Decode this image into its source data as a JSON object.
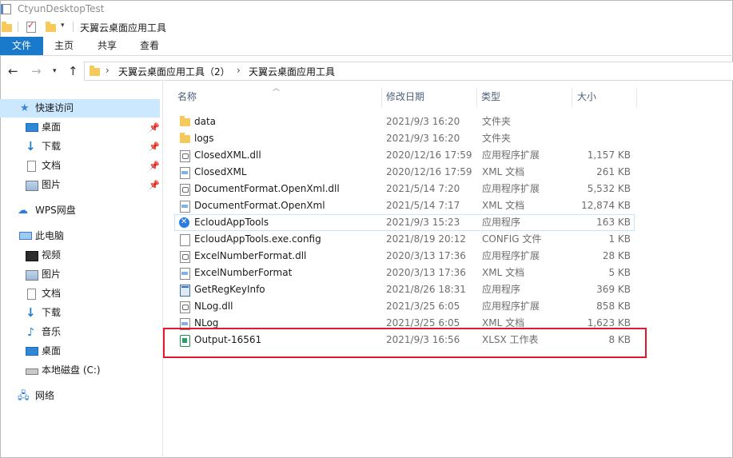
{
  "window": {
    "title": "CtyunDesktopTest"
  },
  "quick_access_toolbar": {
    "path": "天翼云桌面应用工具"
  },
  "ribbon": {
    "tabs": [
      "文件",
      "主页",
      "共享",
      "查看"
    ]
  },
  "address_bar": {
    "crumbs": [
      "天翼云桌面应用工具（2）",
      "天翼云桌面应用工具"
    ]
  },
  "sidebar": {
    "quick_access": {
      "label": "快速访问",
      "items": [
        "桌面",
        "下载",
        "文档",
        "图片"
      ]
    },
    "wps": "WPS网盘",
    "this_pc": {
      "label": "此电脑",
      "items": [
        "视频",
        "图片",
        "文档",
        "下载",
        "音乐",
        "桌面",
        "本地磁盘 (C:)"
      ]
    },
    "network": "网络"
  },
  "columns": {
    "name": "名称",
    "date": "修改日期",
    "type": "类型",
    "size": "大小"
  },
  "files": [
    {
      "name": "data",
      "date": "2021/9/3 16:20",
      "type": "文件夹",
      "size": "",
      "icon": "folder-icon"
    },
    {
      "name": "logs",
      "date": "2021/9/3 16:20",
      "type": "文件夹",
      "size": "",
      "icon": "folder-icon"
    },
    {
      "name": "ClosedXML.dll",
      "date": "2020/12/16 17:59",
      "type": "应用程序扩展",
      "size": "1,157 KB",
      "icon": "dll-icon"
    },
    {
      "name": "ClosedXML",
      "date": "2020/12/16 17:59",
      "type": "XML 文档",
      "size": "261 KB",
      "icon": "xml-icon"
    },
    {
      "name": "DocumentFormat.OpenXml.dll",
      "date": "2021/5/14 7:20",
      "type": "应用程序扩展",
      "size": "5,532 KB",
      "icon": "dll-icon"
    },
    {
      "name": "DocumentFormat.OpenXml",
      "date": "2021/5/14 7:17",
      "type": "XML 文档",
      "size": "12,874 KB",
      "icon": "xml-icon"
    },
    {
      "name": "EcloudAppTools",
      "date": "2021/9/3 15:23",
      "type": "应用程序",
      "size": "163 KB",
      "icon": "exe-icon"
    },
    {
      "name": "EcloudAppTools.exe.config",
      "date": "2021/8/19 20:12",
      "type": "CONFIG 文件",
      "size": "1 KB",
      "icon": "config-icon"
    },
    {
      "name": "ExcelNumberFormat.dll",
      "date": "2020/3/13 17:36",
      "type": "应用程序扩展",
      "size": "28 KB",
      "icon": "dll-icon"
    },
    {
      "name": "ExcelNumberFormat",
      "date": "2020/3/13 17:36",
      "type": "XML 文档",
      "size": "5 KB",
      "icon": "xml-icon"
    },
    {
      "name": "GetRegKeyInfo",
      "date": "2021/8/26 18:31",
      "type": "应用程序",
      "size": "369 KB",
      "icon": "app-icon"
    },
    {
      "name": "NLog.dll",
      "date": "2021/3/25 6:05",
      "type": "应用程序扩展",
      "size": "858 KB",
      "icon": "dll-icon"
    },
    {
      "name": "NLog",
      "date": "2021/3/25 6:05",
      "type": "XML 文档",
      "size": "1,623 KB",
      "icon": "xml-icon"
    },
    {
      "name": "Output-16561",
      "date": "2021/9/3 16:56",
      "type": "XLSX 工作表",
      "size": "8 KB",
      "icon": "xlsx-icon"
    }
  ],
  "colors": {
    "accent": "#1979ca",
    "highlight_box": "#e0192d",
    "selection": "#cce8ff"
  }
}
